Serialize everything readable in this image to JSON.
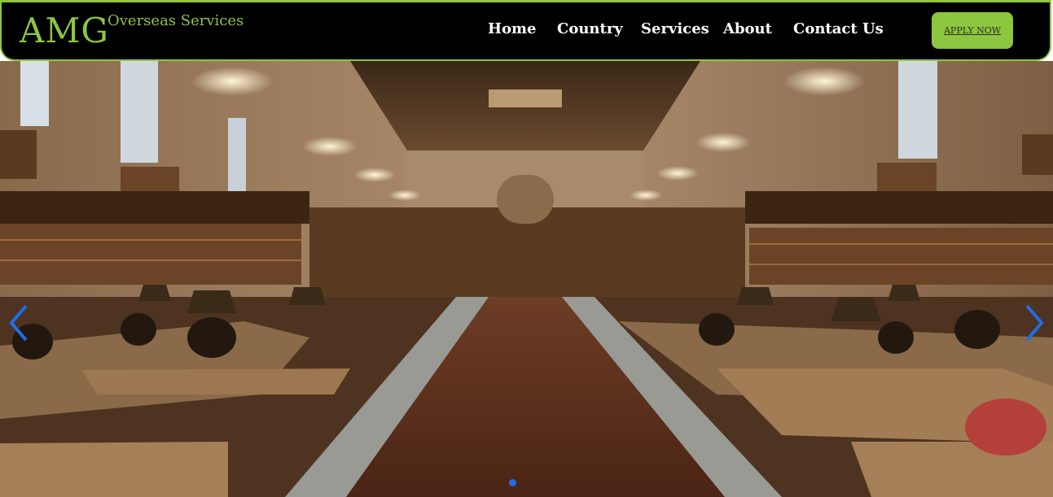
{
  "brand": {
    "name": "AMG",
    "tagline": "Overseas Services"
  },
  "nav": {
    "items": [
      {
        "label": "Home"
      },
      {
        "label": "Country"
      },
      {
        "label": "Services"
      },
      {
        "label": "About"
      },
      {
        "label": "Contact Us"
      }
    ],
    "cta_label": "APPLY NOW"
  },
  "carousel": {
    "image_description": "library reading room photograph",
    "prev_icon": "chevron-left-icon",
    "next_icon": "chevron-right-icon",
    "slide_count": 1,
    "active_slide": 1
  },
  "colors": {
    "brand": "#8dc63f",
    "header_bg": "#000000",
    "indicator": "#1e6ee6",
    "arrow": "#1e6ee6"
  }
}
